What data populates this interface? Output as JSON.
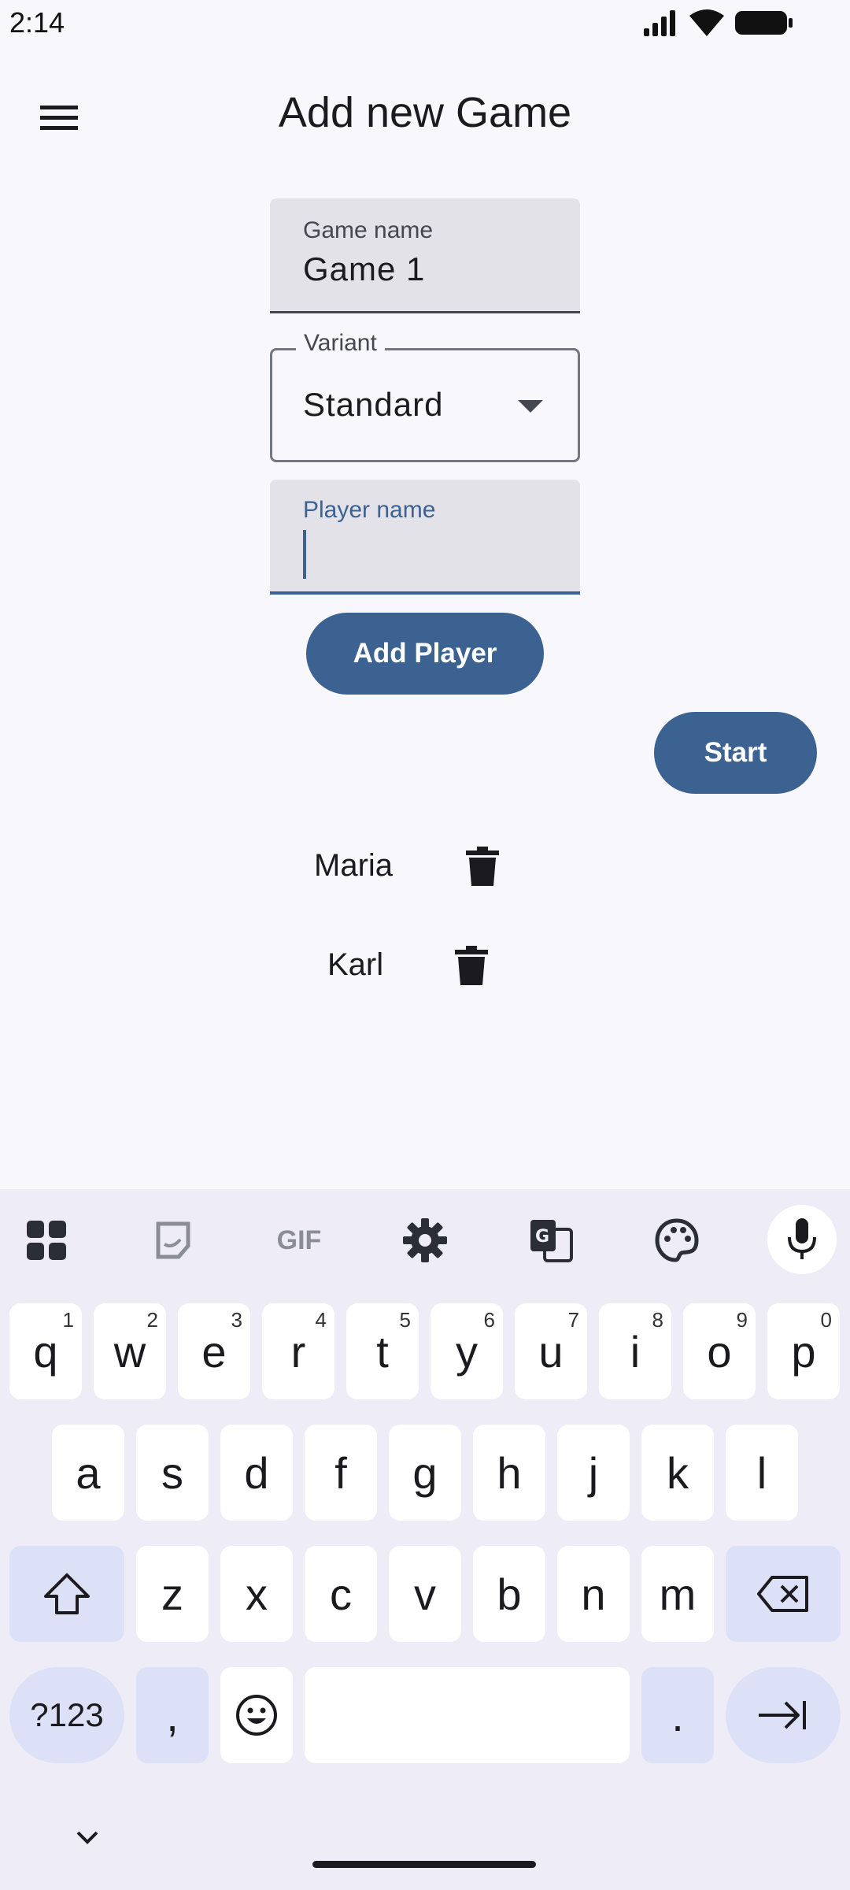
{
  "status": {
    "time": "2:14"
  },
  "appbar": {
    "title": "Add new Game",
    "menu_icon": "menu-icon"
  },
  "form": {
    "game_name_label": "Game name",
    "game_name_value": "Game 1",
    "variant_label": "Variant",
    "variant_value": "Standard",
    "player_name_label": "Player name",
    "player_name_value": ""
  },
  "buttons": {
    "add_player": "Add Player",
    "start": "Start"
  },
  "players": [
    {
      "name": "Maria"
    },
    {
      "name": "Karl"
    }
  ],
  "keyboard": {
    "row1": [
      {
        "k": "q",
        "s": "1"
      },
      {
        "k": "w",
        "s": "2"
      },
      {
        "k": "e",
        "s": "3"
      },
      {
        "k": "r",
        "s": "4"
      },
      {
        "k": "t",
        "s": "5"
      },
      {
        "k": "y",
        "s": "6"
      },
      {
        "k": "u",
        "s": "7"
      },
      {
        "k": "i",
        "s": "8"
      },
      {
        "k": "o",
        "s": "9"
      },
      {
        "k": "p",
        "s": "0"
      }
    ],
    "row2": [
      "a",
      "s",
      "d",
      "f",
      "g",
      "h",
      "j",
      "k",
      "l"
    ],
    "row3": [
      "z",
      "x",
      "c",
      "v",
      "b",
      "n",
      "m"
    ],
    "sym_label": "?123",
    "comma": ",",
    "period": ".",
    "toolbar_gif": "GIF"
  },
  "colors": {
    "primary": "#3c6292",
    "background": "#f8f7fc",
    "field": "#e3e2e8"
  }
}
